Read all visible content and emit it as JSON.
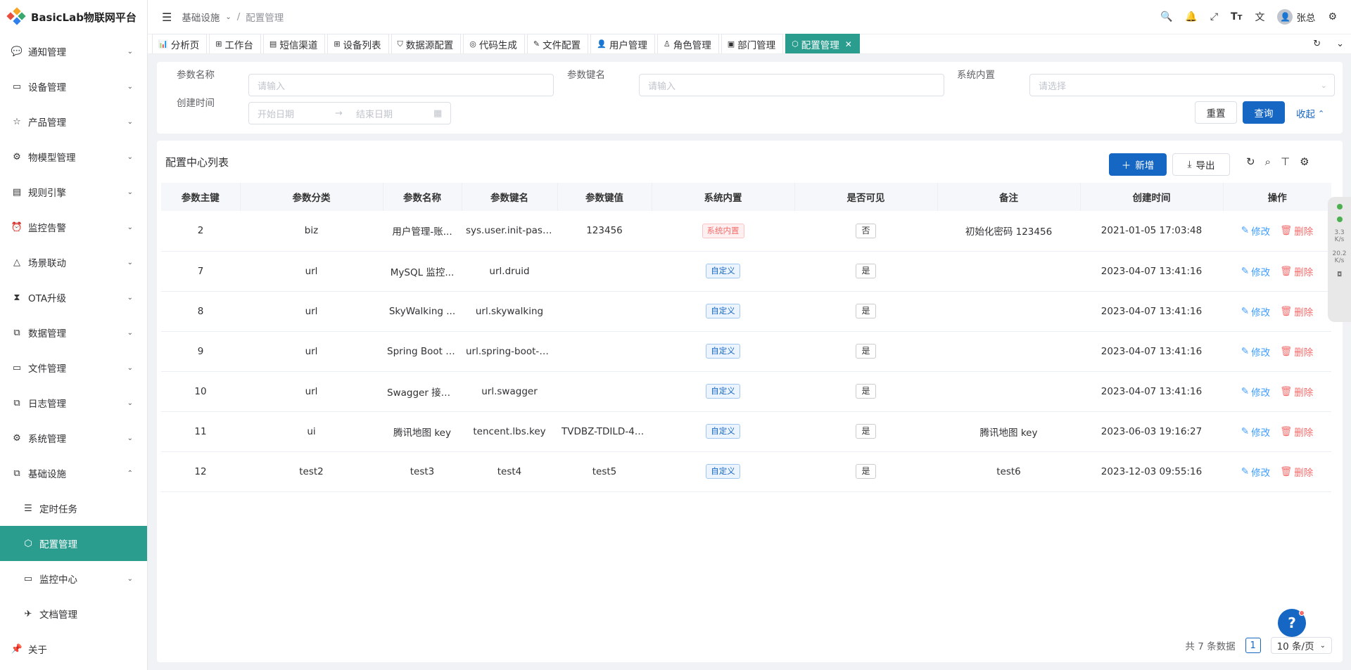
{
  "app": {
    "title": "BasicLab物联网平台"
  },
  "colors": {
    "primary": "#1667c4",
    "active_menu": "#2a9d8f",
    "danger": "#f56c6c"
  },
  "sidebar": {
    "items": [
      {
        "label": "通知管理",
        "icon": "chat-icon"
      },
      {
        "label": "设备管理",
        "icon": "monitor-icon"
      },
      {
        "label": "产品管理",
        "icon": "star-icon"
      },
      {
        "label": "物模型管理",
        "icon": "model-icon"
      },
      {
        "label": "规则引擎",
        "icon": "rule-icon"
      },
      {
        "label": "监控告警",
        "icon": "alarm-icon"
      },
      {
        "label": "场景联动",
        "icon": "scene-icon"
      },
      {
        "label": "OTA升级",
        "icon": "hourglass-icon"
      },
      {
        "label": "数据管理",
        "icon": "copy-icon"
      },
      {
        "label": "文件管理",
        "icon": "folder-icon"
      },
      {
        "label": "日志管理",
        "icon": "log-icon"
      },
      {
        "label": "系统管理",
        "icon": "gear-icon"
      },
      {
        "label": "基础设施",
        "icon": "infra-icon"
      }
    ],
    "sub_items": [
      {
        "label": "定时任务",
        "icon": "list-icon"
      },
      {
        "label": "配置管理",
        "icon": "config-icon"
      },
      {
        "label": "监控中心",
        "icon": "screen-icon"
      },
      {
        "label": "文档管理",
        "icon": "plane-icon"
      }
    ],
    "about": {
      "label": "关于",
      "icon": "pin-icon"
    }
  },
  "header": {
    "breadcrumb": [
      "基础设施",
      "配置管理"
    ],
    "user": "张总"
  },
  "tabs": [
    {
      "label": "分析页",
      "icon": "chart-icon"
    },
    {
      "label": "工作台",
      "icon": "grid-icon"
    },
    {
      "label": "短信渠道",
      "icon": "sms-icon"
    },
    {
      "label": "设备列表",
      "icon": "grid-icon"
    },
    {
      "label": "数据源配置",
      "icon": "datasource-icon"
    },
    {
      "label": "代码生成",
      "icon": "code-icon"
    },
    {
      "label": "文件配置",
      "icon": "edit-icon"
    },
    {
      "label": "用户管理",
      "icon": "user-icon"
    },
    {
      "label": "角色管理",
      "icon": "role-icon"
    },
    {
      "label": "部门管理",
      "icon": "dept-icon"
    },
    {
      "label": "配置管理",
      "icon": "config-icon",
      "active": true
    }
  ],
  "search": {
    "name_label": "参数名称",
    "name_placeholder": "请输入",
    "key_label": "参数键名",
    "key_placeholder": "请输入",
    "builtin_label": "系统内置",
    "builtin_placeholder": "请选择",
    "time_label": "创建时间",
    "start_placeholder": "开始日期",
    "end_placeholder": "结束日期",
    "reset": "重置",
    "query": "查询",
    "collapse": "收起"
  },
  "table": {
    "title": "配置中心列表",
    "add": "新增",
    "export": "导出",
    "columns": [
      "参数主键",
      "参数分类",
      "参数名称",
      "参数键名",
      "参数键值",
      "系统内置",
      "是否可见",
      "备注",
      "创建时间",
      "操作"
    ],
    "rows": [
      {
        "id": "2",
        "category": "biz",
        "name": "用户管理-账...",
        "key": "sys.user.init-pass...",
        "value": "123456",
        "builtin": "系统内置",
        "builtin_type": "danger",
        "visible": "否",
        "remark": "初始化密码 123456",
        "created": "2021-01-05 17:03:48"
      },
      {
        "id": "7",
        "category": "url",
        "name": "MySQL 监控...",
        "key": "url.druid",
        "value": "",
        "builtin": "自定义",
        "builtin_type": "primary",
        "visible": "是",
        "remark": "",
        "created": "2023-04-07 13:41:16"
      },
      {
        "id": "8",
        "category": "url",
        "name": "SkyWalking ...",
        "key": "url.skywalking",
        "value": "",
        "builtin": "自定义",
        "builtin_type": "primary",
        "visible": "是",
        "remark": "",
        "created": "2023-04-07 13:41:16"
      },
      {
        "id": "9",
        "category": "url",
        "name": "Spring Boot A...",
        "key": "url.spring-boot-a...",
        "value": "",
        "builtin": "自定义",
        "builtin_type": "primary",
        "visible": "是",
        "remark": "",
        "created": "2023-04-07 13:41:16"
      },
      {
        "id": "10",
        "category": "url",
        "name": "Swagger 接口...",
        "key": "url.swagger",
        "value": "",
        "builtin": "自定义",
        "builtin_type": "primary",
        "visible": "是",
        "remark": "",
        "created": "2023-04-07 13:41:16"
      },
      {
        "id": "11",
        "category": "ui",
        "name": "腾讯地图 key",
        "key": "tencent.lbs.key",
        "value": "TVDBZ-TDILD-4O...",
        "builtin": "自定义",
        "builtin_type": "primary",
        "visible": "是",
        "remark": "腾讯地图 key",
        "created": "2023-06-03 19:16:27"
      },
      {
        "id": "12",
        "category": "test2",
        "name": "test3",
        "key": "test4",
        "value": "test5",
        "builtin": "自定义",
        "builtin_type": "primary",
        "visible": "是",
        "remark": "test6",
        "created": "2023-12-03 09:55:16"
      }
    ],
    "edit_label": "修改",
    "delete_label": "删除"
  },
  "pagination": {
    "total_text": "共 7 条数据",
    "current": "1",
    "page_size": "10 条/页"
  },
  "side_widget": {
    "upload": "3.3",
    "upload_unit": "K/s",
    "download": "20.2",
    "download_unit": "K/s"
  }
}
